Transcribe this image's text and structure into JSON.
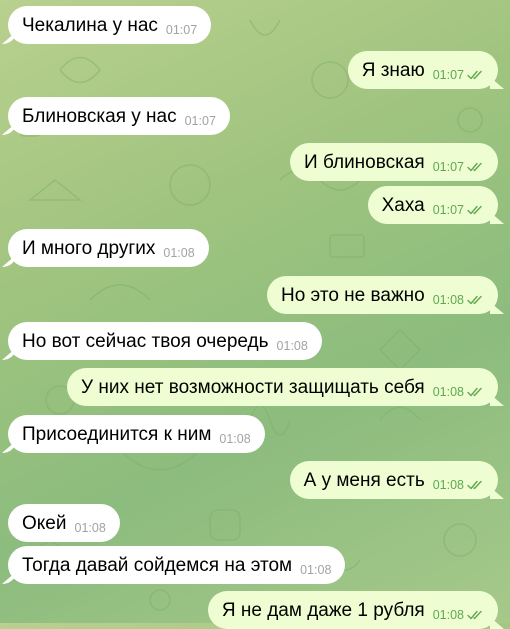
{
  "messages": [
    {
      "dir": "in",
      "text": "Чекалина у нас",
      "time": "01:07"
    },
    {
      "dir": "out",
      "text": "Я знаю",
      "time": "01:07"
    },
    {
      "dir": "in",
      "text": "Блиновская у нас",
      "time": "01:07"
    },
    {
      "dir": "out",
      "text": "И блиновская",
      "time": "01:07"
    },
    {
      "dir": "out",
      "text": "Хаха",
      "time": "01:07"
    },
    {
      "dir": "in",
      "text": "И много других",
      "time": "01:08"
    },
    {
      "dir": "out",
      "text": "Но это не важно",
      "time": "01:08"
    },
    {
      "dir": "in",
      "text": "Но вот сейчас твоя очередь",
      "time": "01:08"
    },
    {
      "dir": "out",
      "text": "У них нет возможности защищать себя",
      "time": "01:08"
    },
    {
      "dir": "in",
      "text": "Присоединится к ним",
      "time": "01:08"
    },
    {
      "dir": "out",
      "text": "А у меня есть",
      "time": "01:08"
    },
    {
      "dir": "in",
      "text": "Окей",
      "time": "01:08"
    },
    {
      "dir": "in",
      "text": "Тогда давай сойдемся на этом",
      "time": "01:08"
    },
    {
      "dir": "out",
      "text": "Я не дам даже 1 рубля",
      "time": "01:08"
    }
  ],
  "colors": {
    "incoming_bubble": "#ffffff",
    "outgoing_bubble": "#eefed2",
    "outgoing_time": "#5fa84f",
    "incoming_time": "#a3a3a3",
    "read_checks": "#5fa84f"
  },
  "icons": {
    "read_receipt": "double-check-icon"
  }
}
